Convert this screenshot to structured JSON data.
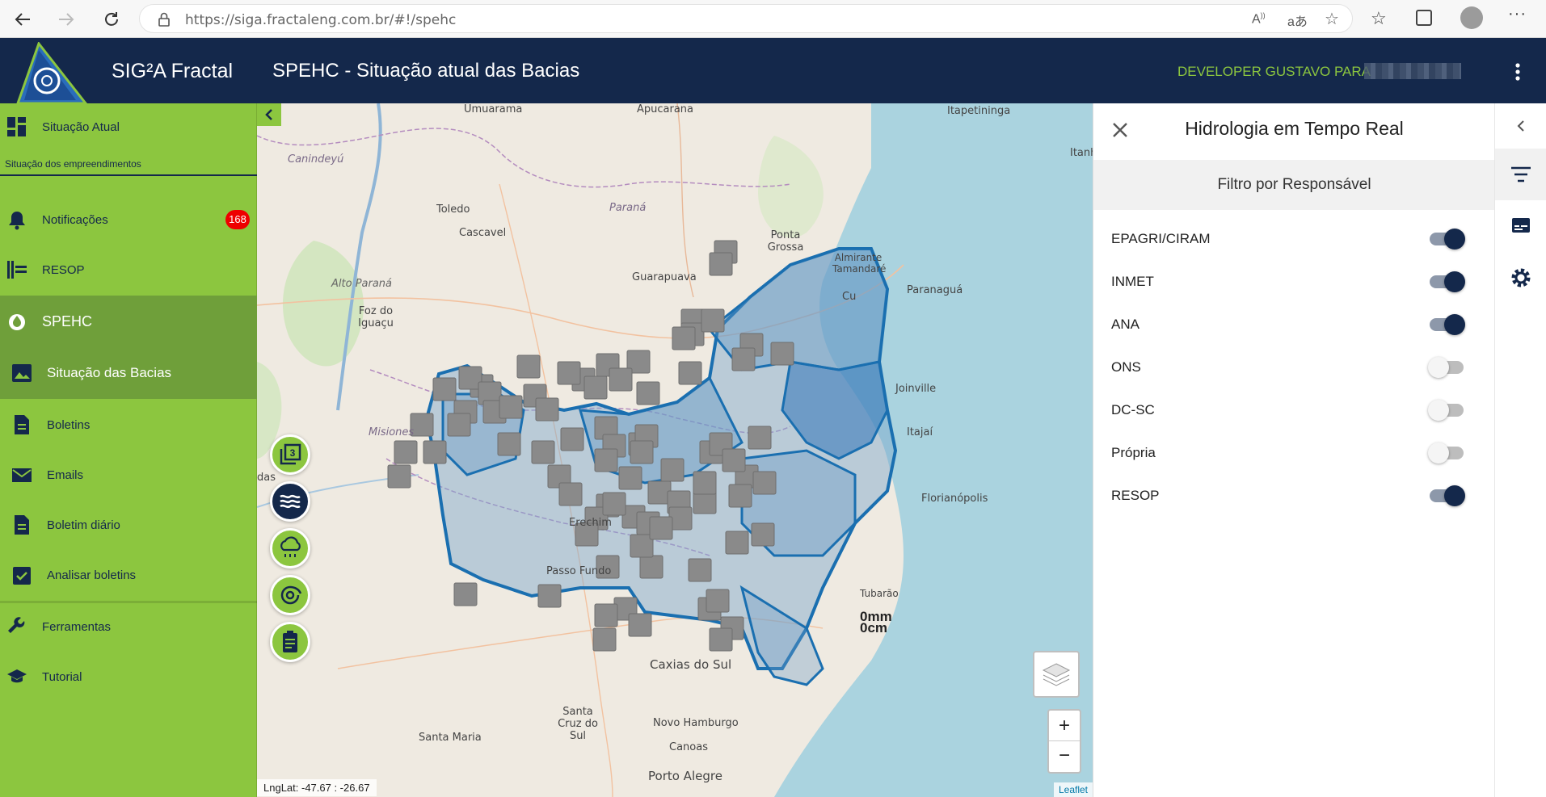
{
  "browser": {
    "url": "https://siga.fractaleng.com.br/#!/spehc"
  },
  "header": {
    "brand": "SIG²A Fractal",
    "page_title": "SPEHC - Situação atual das Bacias",
    "user_label": "DEVELOPER GUSTAVO PARA"
  },
  "sidebar": {
    "items": [
      {
        "label": "Situação Atual",
        "icon": "dashboard-icon"
      },
      {
        "label": "Situação dos empreendimentos"
      },
      {
        "label": "Notificações",
        "icon": "bell-icon",
        "badge": "168"
      },
      {
        "label": "RESOP",
        "icon": "resop-icon"
      },
      {
        "label": "SPEHC",
        "icon": "spehc-icon"
      },
      {
        "label": "Situação das Bacias",
        "icon": "image-icon"
      },
      {
        "label": "Boletins",
        "icon": "document-icon"
      },
      {
        "label": "Emails",
        "icon": "mail-icon"
      },
      {
        "label": "Boletim diário",
        "icon": "document-icon"
      },
      {
        "label": "Analisar boletins",
        "icon": "check-clipboard-icon"
      },
      {
        "label": "Ferramentas",
        "icon": "wrench-icon"
      },
      {
        "label": "Tutorial",
        "icon": "graduation-cap-icon"
      }
    ]
  },
  "map": {
    "place_labels": [
      "Umuarama",
      "Apucarana",
      "Itapetininga",
      "Canindeyú",
      "Itanh",
      "Toledo",
      "Cascavel",
      "Paraná",
      "Ponta Grossa",
      "Almirante Tamandaré",
      "Paranaguá",
      "Guarapuava",
      "Alto Paraná",
      "Foz do Iguaçu",
      "Cu",
      "Joinville",
      "Misiones",
      "Itajaí",
      "das",
      "Florianópolis",
      "Erechim",
      "Passo Fundo",
      "Tubarão",
      "Caxias do Sul",
      "Santa Cruz do Sul",
      "Novo Hamburgo",
      "Santa Maria",
      "Canoas",
      "Porto Alegre"
    ],
    "readout_mm": "0mm",
    "readout_cm": "0cm",
    "coords": "LngLat: -47.67 : -26.67",
    "attribution": "Leaflet",
    "zoom_in": "+",
    "zoom_out": "−"
  },
  "panel": {
    "title": "Hidrologia em Tempo Real",
    "filter_heading": "Filtro por Responsável",
    "filters": [
      {
        "label": "EPAGRI/CIRAM",
        "on": true
      },
      {
        "label": "INMET",
        "on": true
      },
      {
        "label": "ANA",
        "on": true
      },
      {
        "label": "ONS",
        "on": false
      },
      {
        "label": "DC-SC",
        "on": false
      },
      {
        "label": "Própria",
        "on": false
      },
      {
        "label": "RESOP",
        "on": true
      }
    ]
  },
  "colors": {
    "navy": "#14284b",
    "green": "#8cc63f",
    "green_dark": "#6f9f3a",
    "basin_blue": "#1a6fb0",
    "station_gray": "#8a8a8a"
  }
}
